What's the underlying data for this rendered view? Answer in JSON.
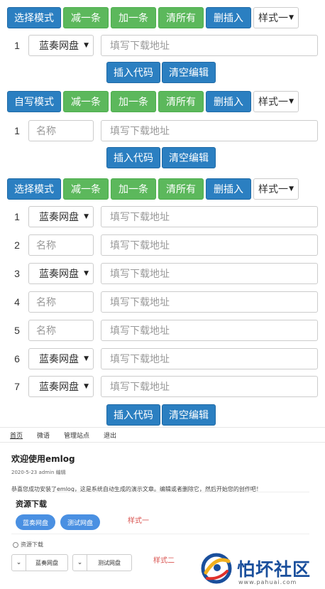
{
  "toolbar1": {
    "mode_label": "选择模式",
    "minus_label": "减一条",
    "plus_label": "加一条",
    "clear_all_label": "清所有",
    "delete_insert_label": "删插入",
    "style_select_value": "样式一"
  },
  "section1": {
    "rows": [
      {
        "num": "1",
        "type_value": "蓝奏网盘",
        "url_placeholder": "填写下载地址"
      }
    ],
    "insert_code_label": "插入代码",
    "clear_edit_label": "清空编辑"
  },
  "toolbar2": {
    "mode_label": "自写模式",
    "minus_label": "减一条",
    "plus_label": "加一条",
    "clear_all_label": "清所有",
    "delete_insert_label": "删插入",
    "style_select_value": "样式一"
  },
  "section2": {
    "rows": [
      {
        "num": "1",
        "name_placeholder": "名称",
        "url_placeholder": "填写下载地址"
      }
    ],
    "insert_code_label": "插入代码",
    "clear_edit_label": "清空编辑"
  },
  "toolbar3": {
    "mode_label": "选择模式",
    "minus_label": "减一条",
    "plus_label": "加一条",
    "clear_all_label": "清所有",
    "delete_insert_label": "删插入",
    "style_select_value": "样式一"
  },
  "section3": {
    "rows": [
      {
        "num": "1",
        "first": "蓝奏网盘",
        "url_placeholder": "填写下载地址"
      },
      {
        "num": "2",
        "first": "名称",
        "url_placeholder": "填写下载地址"
      },
      {
        "num": "3",
        "first": "蓝奏网盘",
        "url_placeholder": "填写下载地址"
      },
      {
        "num": "4",
        "first": "名称",
        "url_placeholder": "填写下载地址"
      },
      {
        "num": "5",
        "first": "名称",
        "url_placeholder": "填写下载地址"
      },
      {
        "num": "6",
        "first": "蓝奏网盘",
        "url_placeholder": "填写下载地址"
      },
      {
        "num": "7",
        "first": "蓝奏网盘",
        "url_placeholder": "填写下载地址"
      }
    ],
    "insert_code_label": "插入代码",
    "clear_edit_label": "清空编辑"
  },
  "nav": [
    "首页",
    "微语",
    "管理站点",
    "退出"
  ],
  "post": {
    "title": "欢迎使用emlog",
    "meta": "2020-5-23 admin 编辑",
    "body": "恭喜您成功安装了emlog，这是系统自动生成的演示文章。编辑或者删除它，然后开始您的创作吧！"
  },
  "resources": {
    "title": "资源下载",
    "pill1": "蓝奏网盘",
    "pill2": "测试网盘",
    "style1_label": "样式一",
    "attach_label": "资源下载",
    "btn1": "蓝奏网盘",
    "btn2": "测试网盘",
    "style2_label": "样式二"
  },
  "watermark": {
    "text": "怕坏社区",
    "url": "www.pahuai.com"
  },
  "colors": {
    "blue_button": "#2b7fc1",
    "green_button": "#5cb85c",
    "pill_blue": "#4a90e2",
    "style_label_red": "#d9534f"
  }
}
